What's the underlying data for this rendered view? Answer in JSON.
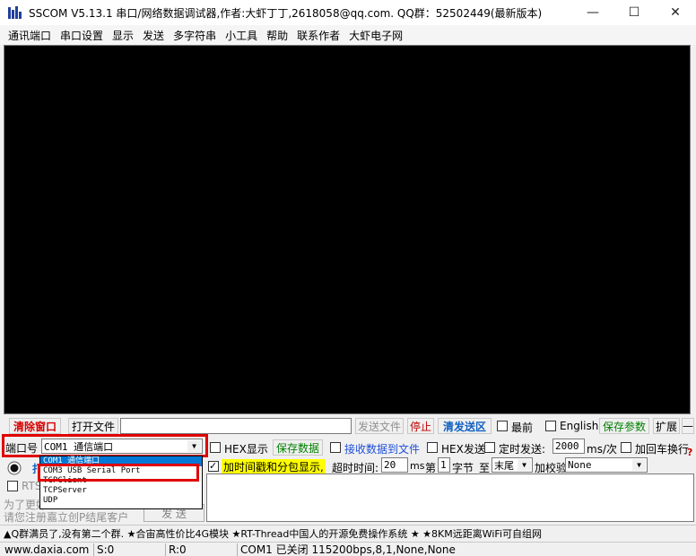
{
  "window": {
    "title": "SSCOM V5.13.1 串口/网络数据调试器,作者:大虾丁丁,2618058@qq.com. QQ群：52502449(最新版本)",
    "minimize": "—",
    "maximize": "☐",
    "close": "✕"
  },
  "menu": [
    "通讯端口",
    "串口设置",
    "显示",
    "发送",
    "多字符串",
    "小工具",
    "帮助",
    "联系作者",
    "大虾电子网"
  ],
  "toolbar1": {
    "clear_window": "清除窗口",
    "open_file": "打开文件",
    "file_path": "",
    "send_file": "发送文件",
    "stop": "停止",
    "clear_send_area": "清发送区",
    "top_most": "最前",
    "english": "English",
    "save_params": "保存参数",
    "expand": "扩展",
    "collapse": "—"
  },
  "toolbar2": {
    "port_label": "端口号",
    "port_value": "COM1 通信端口",
    "hex_display": "HEX显示",
    "save_data": "保存数据",
    "recv_to_file": "接收数据到文件",
    "hex_send": "HEX发送",
    "timed_send": "定时发送:",
    "interval": "2000",
    "interval_unit": "ms/次",
    "add_newline": "加回车换行",
    "help_mark": "?"
  },
  "port_options": [
    "COM1 通信端口",
    "COM3 USB Serial Port",
    "TCPClient",
    "TCPServer",
    "UDP"
  ],
  "toolbar3": {
    "open_btn_partial": "打",
    "timestamp": "加时间戳和分包显示,",
    "timeout_label": "超时时间:",
    "timeout_value": "20",
    "timeout_unit": "ms",
    "byte_prefix": "第",
    "byte_index": "1",
    "byte_label": "字节",
    "to_label": "至",
    "end_value": "末尾",
    "checksum_label": "加校验",
    "checksum_value": "None"
  },
  "left_panel": {
    "rts": "RTS",
    "note1": "为了更好",
    "note2": "请您注册嘉立创P结尾客户",
    "send_btn": "发 送"
  },
  "marquee": "▲Q群满员了,没有第二个群. ★合宙高性价比4G模块 ★RT-Thread中国人的开源免费操作系统 ★ ★8KM远距离WiFi可自组网",
  "status": {
    "website": "www.daxia.com",
    "sent": "S:0",
    "received": "R:0",
    "port_status": "COM1 已关闭  115200bps,8,1,None,None"
  }
}
